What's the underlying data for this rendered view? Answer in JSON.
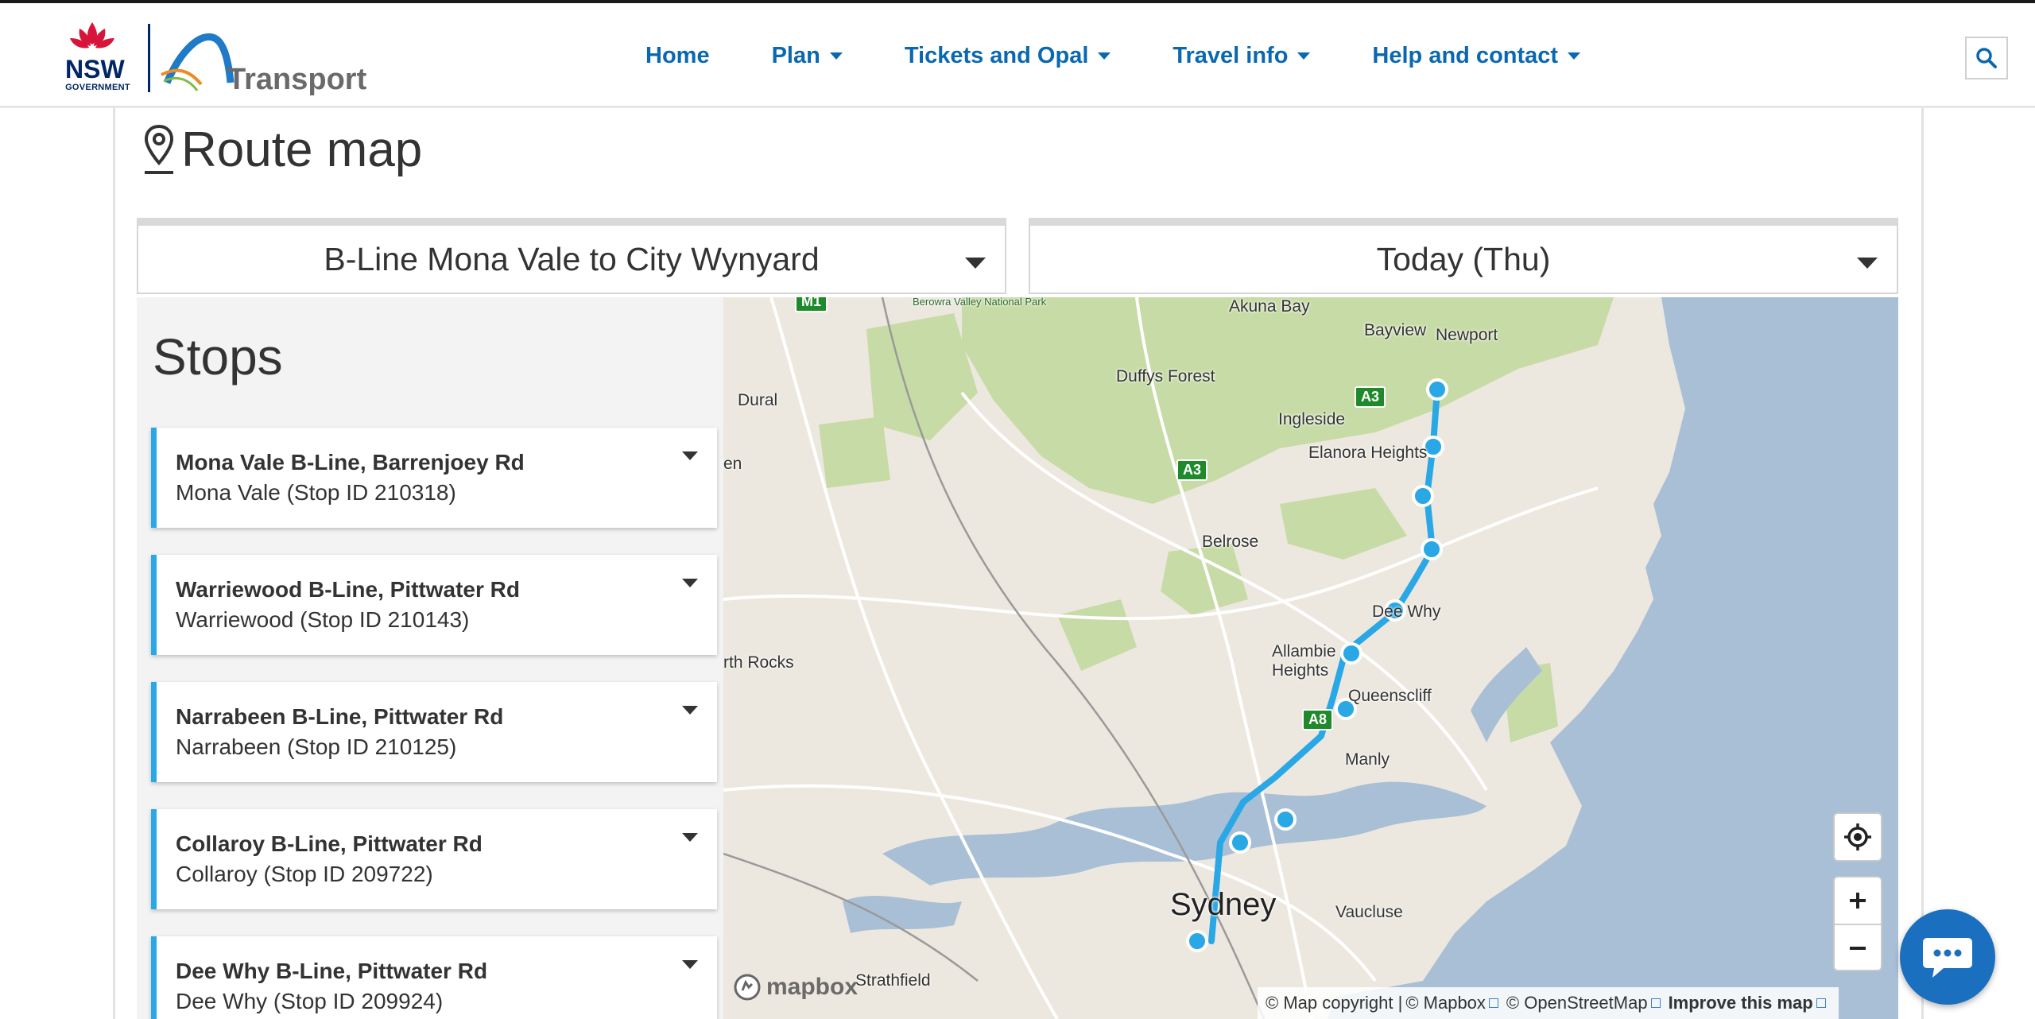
{
  "header": {
    "brand": "Transport",
    "gov_label": "GOVERNMENT",
    "nav": [
      {
        "label": "Home",
        "has_dropdown": false
      },
      {
        "label": "Plan",
        "has_dropdown": true
      },
      {
        "label": "Tickets and Opal",
        "has_dropdown": true
      },
      {
        "label": "Travel info",
        "has_dropdown": true
      },
      {
        "label": "Help and contact",
        "has_dropdown": true
      }
    ],
    "search_icon": "search-icon"
  },
  "page": {
    "title": "Route map",
    "title_icon": "map-pin-icon"
  },
  "filters": {
    "route": "B-Line Mona Vale to City Wynyard",
    "date": "Today (Thu)"
  },
  "stops": {
    "heading": "Stops",
    "items": [
      {
        "name": "Mona Vale B-Line, Barrenjoey Rd",
        "detail": "Mona Vale (Stop ID 210318)"
      },
      {
        "name": "Warriewood B-Line, Pittwater Rd",
        "detail": "Warriewood (Stop ID 210143)"
      },
      {
        "name": "Narrabeen B-Line, Pittwater Rd",
        "detail": "Narrabeen (Stop ID 210125)"
      },
      {
        "name": "Collaroy B-Line, Pittwater Rd",
        "detail": "Collaroy (Stop ID 209722)"
      },
      {
        "name": "Dee Why B-Line, Pittwater Rd",
        "detail": "Dee Why (Stop ID 209924)"
      }
    ]
  },
  "map": {
    "labels": {
      "akuna_bay": "Akuna Bay",
      "bayview": "Bayview",
      "newport": "Newport",
      "dural": "Dural",
      "duffys_forest": "Duffys Forest",
      "ingleside": "Ingleside",
      "elanora_heights": "Elanora Heights",
      "belrose": "Belrose",
      "dee_why": "Dee Why",
      "allambie_heights": "Allambie Heights",
      "queenscliff": "Queenscliff",
      "manly": "Manly",
      "north_rocks": "rth Rocks",
      "sydney": "Sydney",
      "vaucluse": "Vaucluse",
      "strathfield": "Strathfield",
      "berowra": "Berowra Valley National Park",
      "en": "en"
    },
    "shields": {
      "a3_north": "A3",
      "a3_west": "A3",
      "a8": "A8",
      "m1": "M1"
    },
    "route_color": "#2aa7e5",
    "water_color": "#a9bfd6",
    "land_color": "#ece8df",
    "park_color": "#c7dba6",
    "mapbox_label": "mapbox",
    "attribution": {
      "copyright": "© Map copyright | ",
      "mapbox": "© Mapbox",
      "osm": "© OpenStreetMap",
      "improve": "Improve this map"
    },
    "controls": [
      "locate-icon",
      "zoom-in-icon",
      "zoom-out-icon"
    ]
  },
  "chat": {
    "icon": "chat-icon"
  }
}
